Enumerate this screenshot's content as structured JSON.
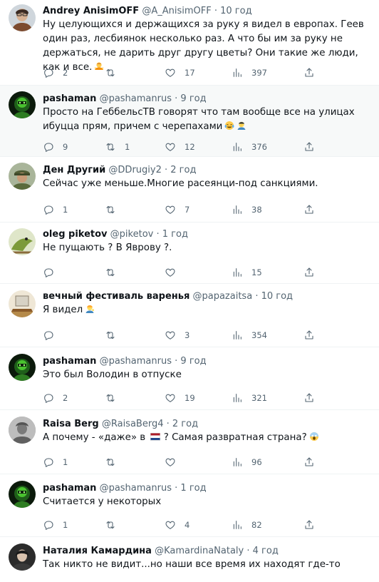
{
  "tweets": [
    {
      "name": "Andrey AnisimOFF",
      "handle": "@A_AnisimOFF",
      "sep": "·",
      "time": "10 год",
      "text": "Ну целующихся и держащихся за руку я видел в европах. Геев один раз, лесбиянок несколько раз. А что бы им за руку не держаться, не дарить друг другу цветы? Они такие же люди, как и все.",
      "emoji": [
        "person-shrugging-emoji"
      ],
      "replies": "2",
      "retweets": "",
      "likes": "17",
      "views": "397",
      "avatar": "avatar-andrey",
      "highlighted": false
    },
    {
      "name": "pashaman",
      "handle": "@pashamanrus",
      "sep": "·",
      "time": "9 год",
      "text": "Просто на ГеббельсТВ говорят что там вообще все на улицах ибуцца прям, причем с черепахами",
      "emoji": [
        "tears-of-joy-emoji",
        "man-facepalming-emoji"
      ],
      "replies": "9",
      "retweets": "1",
      "likes": "12",
      "views": "376",
      "avatar": "avatar-pashaman",
      "highlighted": true
    },
    {
      "name": "Ден Другий",
      "handle": "@DDrugiy2",
      "sep": "·",
      "time": "2 год",
      "text": "Сейчас уже меньше.Многие расеянци-под санкциями.",
      "emoji": [],
      "replies": "1",
      "retweets": "",
      "likes": "7",
      "views": "38",
      "avatar": "avatar-den",
      "highlighted": false
    },
    {
      "name": "oleg piketov",
      "handle": "@piketov",
      "sep": "·",
      "time": "1 год",
      "text": "Не пущають ? В Яврову ?.",
      "emoji": [],
      "replies": "",
      "retweets": "",
      "likes": "",
      "views": "15",
      "avatar": "avatar-oleg",
      "highlighted": false
    },
    {
      "name": "вечный фестиваль варенья",
      "handle": "@papazaitsa",
      "sep": "·",
      "time": "10 год",
      "text": "Я видел",
      "emoji": [
        "person-tipping-hand-emoji"
      ],
      "replies": "",
      "retweets": "",
      "likes": "3",
      "views": "354",
      "avatar": "avatar-varenya",
      "highlighted": false
    },
    {
      "name": "pashaman",
      "handle": "@pashamanrus",
      "sep": "·",
      "time": "9 год",
      "text": "Это был Володин в отпуске",
      "emoji": [],
      "replies": "2",
      "retweets": "",
      "likes": "19",
      "views": "321",
      "avatar": "avatar-pashaman",
      "highlighted": false
    },
    {
      "name": "Raisa Berg",
      "handle": "@RaisaBerg4",
      "sep": "·",
      "time": "2 год",
      "text_before": "А почему - «даже» в",
      "text_after": "? Самая развратная страна?",
      "emoji": [
        "netherlands-flag-emoji",
        "screaming-face-emoji"
      ],
      "replies": "1",
      "retweets": "",
      "likes": "",
      "views": "96",
      "avatar": "avatar-raisa",
      "highlighted": false
    },
    {
      "name": "pashaman",
      "handle": "@pashamanrus",
      "sep": "·",
      "time": "1 год",
      "text": "Считается у некоторых",
      "emoji": [],
      "replies": "1",
      "retweets": "",
      "likes": "4",
      "views": "82",
      "avatar": "avatar-pashaman",
      "highlighted": false
    },
    {
      "name": "Наталия Камардина",
      "handle": "@KamardinaNataly",
      "sep": "·",
      "time": "4 год",
      "text": "Так никто не видит...но наши все время их находят где-то",
      "emoji": [],
      "avatar": "avatar-natalia",
      "highlighted": false
    }
  ],
  "icons": {
    "reply": "reply-icon",
    "retweet": "retweet-icon",
    "like": "heart-icon",
    "views": "views-chart-icon",
    "share": "share-icon"
  },
  "colors": {
    "text": "#0f1419",
    "secondary": "#536471",
    "divider": "#eff3f4",
    "highlight_bg": "#f7f9f9"
  }
}
